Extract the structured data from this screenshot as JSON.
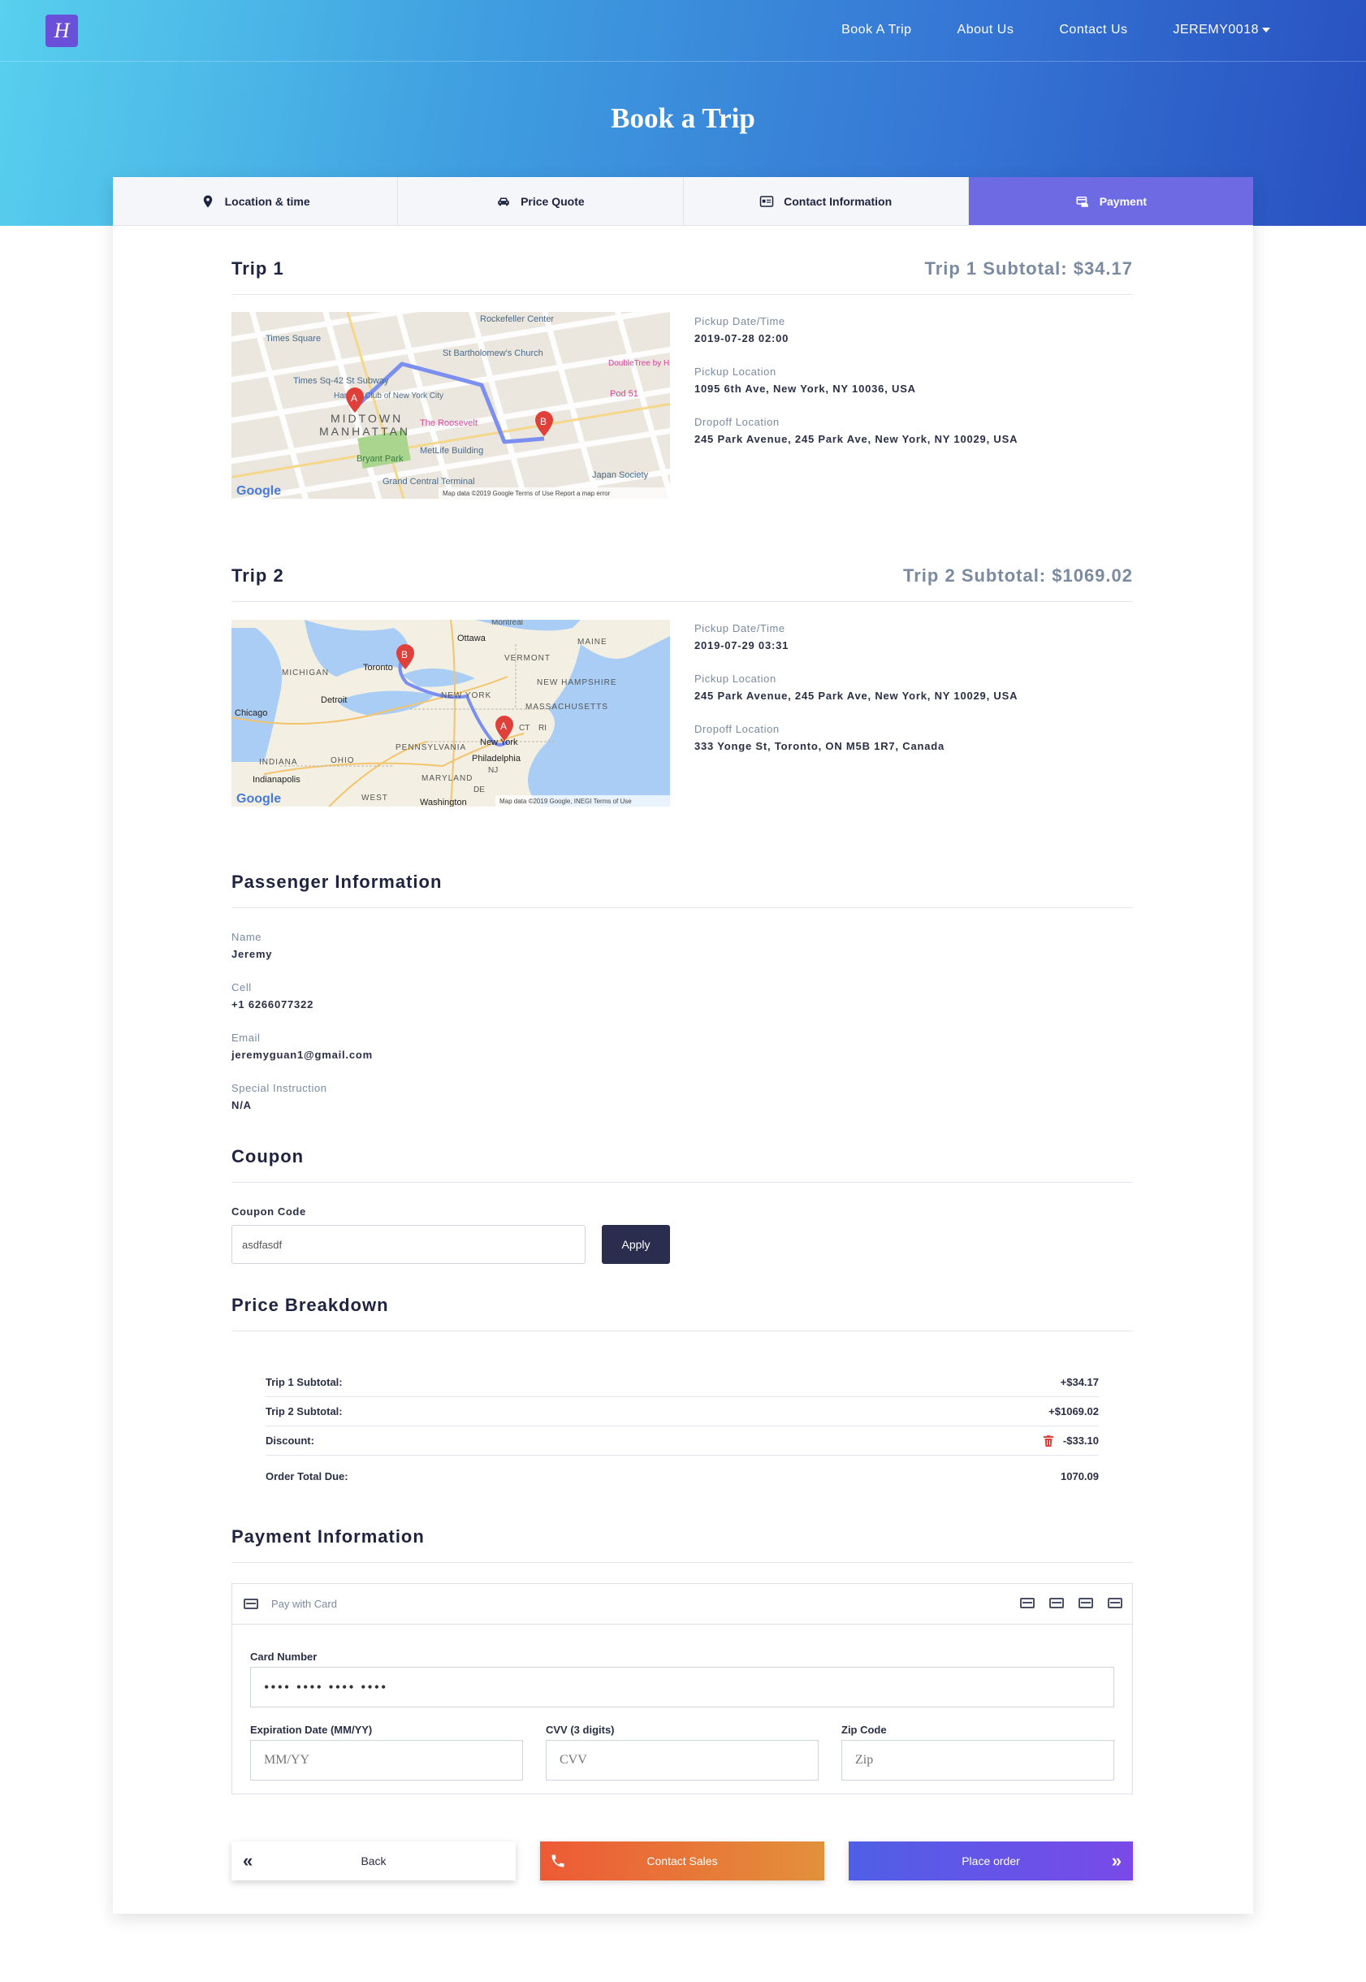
{
  "nav": {
    "logo_text": "H",
    "links": [
      "Book A Trip",
      "About Us",
      "Contact Us"
    ],
    "user": "JEREMY0018"
  },
  "page_title": "Book a Trip",
  "tabs": [
    {
      "label": "Location & time",
      "icon": "map-pin-icon"
    },
    {
      "label": "Price Quote",
      "icon": "car-icon"
    },
    {
      "label": "Contact Information",
      "icon": "id-card-icon"
    },
    {
      "label": "Payment",
      "icon": "payment-icon",
      "active": true
    }
  ],
  "trips": [
    {
      "title": "Trip 1",
      "subtotal": "Trip 1 Subtotal: $34.17",
      "pickup_datetime_label": "Pickup Date/Time",
      "pickup_datetime": "2019-07-28 02:00",
      "pickup_location_label": "Pickup Location",
      "pickup_location": "1095 6th Ave, New York, NY 10036, USA",
      "dropoff_location_label": "Dropoff Location",
      "dropoff_location": "245 Park Avenue, 245 Park Ave, New York, NY 10029, USA",
      "map": {
        "labels": [
          "Times Square",
          "Rockefeller Center",
          "St Bartholomew's Church",
          "Times Sq-42 St Subway",
          "Harvard Club of New York City",
          "MIDTOWN",
          "MANHATTAN",
          "The Roosevelt",
          "MetLife Building",
          "Bryant Park",
          "Grand Central Terminal",
          "DoubleTree by Hilton Metropolitan",
          "Pod 51",
          "Japan Society"
        ],
        "attribution": "Map data ©2019 Google   Terms of Use   Report a map error",
        "brand": "Google"
      }
    },
    {
      "title": "Trip 2",
      "subtotal": "Trip 2 Subtotal: $1069.02",
      "pickup_datetime_label": "Pickup Date/Time",
      "pickup_datetime": "2019-07-29 03:31",
      "pickup_location_label": "Pickup Location",
      "pickup_location": "245 Park Avenue, 245 Park Ave, New York, NY 10029, USA",
      "dropoff_location_label": "Dropoff Location",
      "dropoff_location": "333 Yonge St, Toronto, ON M5B 1R7, Canada",
      "map": {
        "labels": [
          "Montreal",
          "Ottawa",
          "MAINE",
          "VERMONT",
          "MICHIGAN",
          "Toronto",
          "NEW HAMPSHIRE",
          "NEW YORK",
          "MASSACHUSETTS",
          "Detroit",
          "Chicago",
          "CT",
          "RI",
          "New York",
          "PENNSYLVANIA",
          "Philadelphia",
          "INDIANA",
          "OHIO",
          "NJ",
          "Indianapolis",
          "MARYLAND",
          "WEST",
          "DE",
          "Washington"
        ],
        "attribution": "Map data ©2019 Google, INEGI   Terms of Use",
        "brand": "Google"
      }
    }
  ],
  "passenger": {
    "heading": "Passenger Information",
    "name_label": "Name",
    "name": "Jeremy",
    "cell_label": "Cell",
    "cell": "+1 6266077322",
    "email_label": "Email",
    "email": "jeremyguan1@gmail.com",
    "special_label": "Special Instruction",
    "special": "N/A"
  },
  "coupon": {
    "heading": "Coupon",
    "label": "Coupon Code",
    "value": "asdfasdf",
    "apply": "Apply"
  },
  "price": {
    "heading": "Price Breakdown",
    "rows": [
      {
        "label": "Trip 1 Subtotal:",
        "value": "+$34.17"
      },
      {
        "label": "Trip 2 Subtotal:",
        "value": "+$1069.02"
      },
      {
        "label": "Discount:",
        "value": "-$33.10"
      },
      {
        "label": "Order Total Due:",
        "value": "1070.09"
      }
    ]
  },
  "payment": {
    "heading": "Payment Information",
    "pay_with": "Pay with Card",
    "card_number_label": "Card Number",
    "card_number": "•••• •••• •••• ••••",
    "expiry_label": "Expiration Date (MM/YY)",
    "expiry_placeholder": "MM/YY",
    "cvv_label": "CVV (3 digits)",
    "cvv_placeholder": "CVV",
    "zip_label": "Zip Code",
    "zip_placeholder": "Zip"
  },
  "buttons": {
    "back": "Back",
    "contact_sales": "Contact Sales",
    "place_order": "Place order"
  },
  "colors": {
    "accent": "#6d6ae4",
    "header_start": "#58d0ee",
    "header_end": "#2850c0",
    "dark_button": "#2b2d4f",
    "marker": "#e0403a"
  }
}
